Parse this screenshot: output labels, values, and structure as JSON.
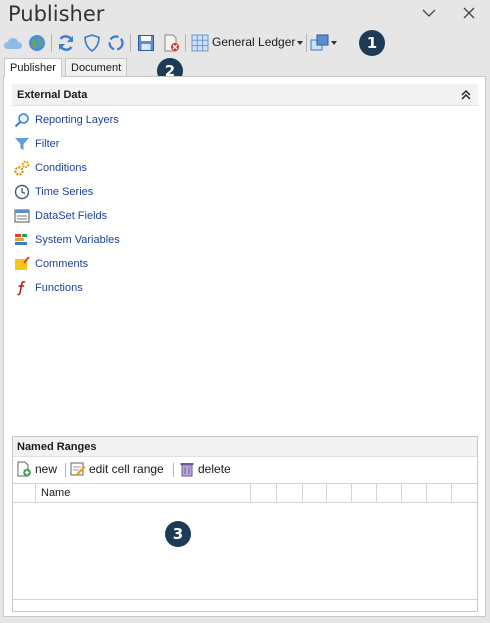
{
  "window": {
    "title": "Publisher"
  },
  "toolbar": {
    "ledger_label": "General Ledger"
  },
  "callouts": [
    "1",
    "2",
    "3"
  ],
  "tabs": [
    {
      "label": "Publisher",
      "active": true
    },
    {
      "label": "Document",
      "active": false
    }
  ],
  "external_data": {
    "header": "External Data",
    "items": [
      {
        "label": "Reporting Layers",
        "icon": "magnifier-icon"
      },
      {
        "label": "Filter",
        "icon": "funnel-icon"
      },
      {
        "label": "Conditions",
        "icon": "gears-icon"
      },
      {
        "label": "Time Series",
        "icon": "clock-icon"
      },
      {
        "label": "DataSet Fields",
        "icon": "dataset-icon"
      },
      {
        "label": "System Variables",
        "icon": "variables-icon"
      },
      {
        "label": "Comments",
        "icon": "comment-icon"
      },
      {
        "label": "Functions",
        "icon": "function-icon"
      }
    ]
  },
  "named_ranges": {
    "header": "Named Ranges",
    "new_label": "new",
    "edit_label": "edit cell range",
    "delete_label": "delete",
    "column_name": "Name"
  },
  "colors": {
    "link": "#1f3f9a",
    "callout": "#1d3a57"
  }
}
